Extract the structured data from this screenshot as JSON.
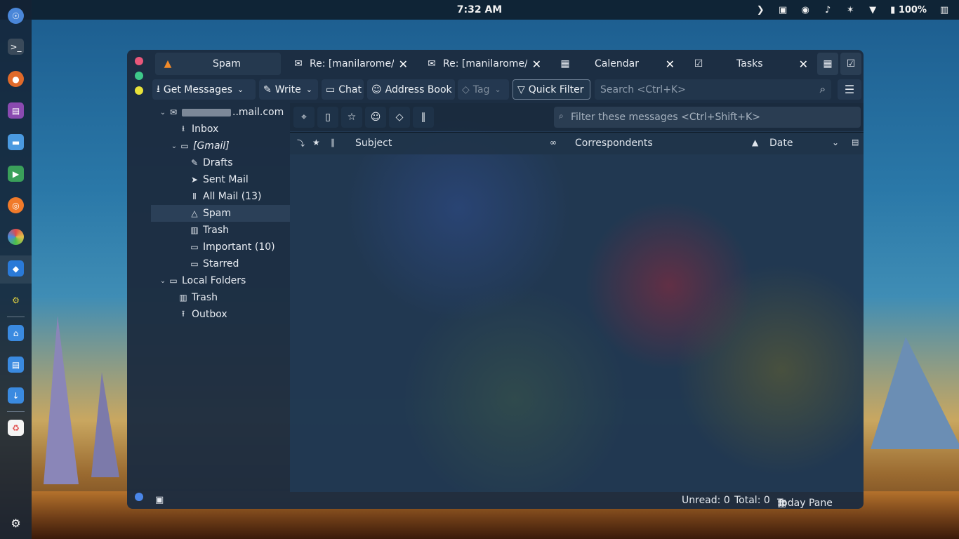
{
  "topbar": {
    "clock": "7:32 AM",
    "battery": "100%"
  },
  "window": {
    "tabs": [
      {
        "label": "Spam",
        "icon": "flame-icon",
        "active": true
      },
      {
        "label": "Re: [manilarome/t",
        "icon": "envelope-icon",
        "active": false
      },
      {
        "label": "Re: [manilarome/t",
        "icon": "envelope-icon",
        "active": false
      },
      {
        "label": "Calendar",
        "icon": "calendar-icon",
        "active": false
      },
      {
        "label": "Tasks",
        "icon": "tasks-icon",
        "active": false
      }
    ],
    "toolbar": {
      "get_messages": "Get Messages",
      "write": "Write",
      "chat": "Chat",
      "address_book": "Address Book",
      "tag": "Tag",
      "quick_filter": "Quick Filter",
      "search_placeholder": "Search <Ctrl+K>"
    },
    "folders": {
      "account_suffix": "..mail.com",
      "items": [
        {
          "label": "Inbox",
          "icon": "inbox-icon"
        },
        {
          "label": "[Gmail]",
          "icon": "folder-icon"
        },
        {
          "label": "Drafts",
          "icon": "pencil-icon"
        },
        {
          "label": "Sent Mail",
          "icon": "send-icon"
        },
        {
          "label": "All Mail (13)",
          "icon": "archive-icon"
        },
        {
          "label": "Spam",
          "icon": "flame-icon"
        },
        {
          "label": "Trash",
          "icon": "trash-icon"
        },
        {
          "label": "Important (10)",
          "icon": "folder-icon"
        },
        {
          "label": "Starred",
          "icon": "folder-icon"
        },
        {
          "label": "Local Folders",
          "icon": "computer-icon"
        },
        {
          "label": "Trash",
          "icon": "trash-icon"
        },
        {
          "label": "Outbox",
          "icon": "outbox-icon"
        }
      ]
    },
    "thread": {
      "filter_placeholder": "Filter these messages <Ctrl+Shift+K>",
      "columns": {
        "subject": "Subject",
        "correspondents": "Correspondents",
        "date": "Date"
      }
    },
    "status": {
      "unread": "Unread: 0",
      "total": "Total: 0",
      "today_pane": "Today Pane"
    }
  },
  "colors": {
    "traffic_close": "#e8577a",
    "traffic_min": "#3ec98a",
    "traffic_max": "#e8e23a"
  }
}
